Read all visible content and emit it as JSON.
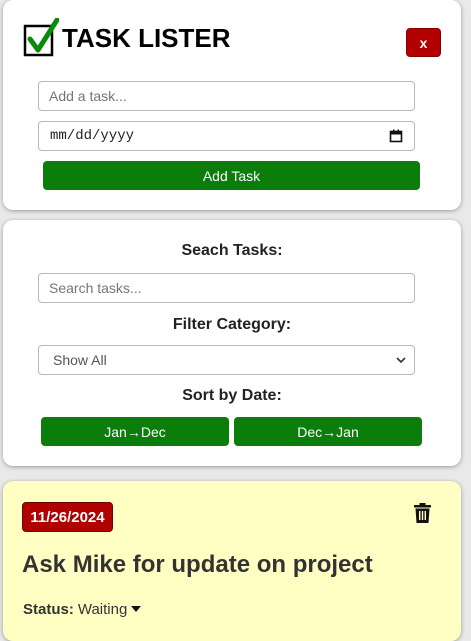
{
  "app": {
    "title": "TASK LISTER",
    "close_label": "x",
    "logo_icon": "checkmark-box-icon"
  },
  "add_form": {
    "task_placeholder": "Add a task...",
    "date_placeholder": "mm/dd/yyyy",
    "add_button": "Add Task"
  },
  "filters": {
    "search_label": "Seach Tasks:",
    "search_placeholder": "Search tasks...",
    "category_label": "Filter Category:",
    "category_selected": "Show All",
    "sort_label": "Sort by Date:",
    "sort_asc": "Jan→Dec",
    "sort_desc": "Dec→Jan"
  },
  "tasks": [
    {
      "date": "11/26/2024",
      "title": "Ask Mike for update on project",
      "status_label": "Status:",
      "status_value": "Waiting"
    }
  ],
  "colors": {
    "accent_green": "#0a7d0a",
    "danger_red": "#b30000",
    "task_card_bg": "#ffffc4"
  }
}
